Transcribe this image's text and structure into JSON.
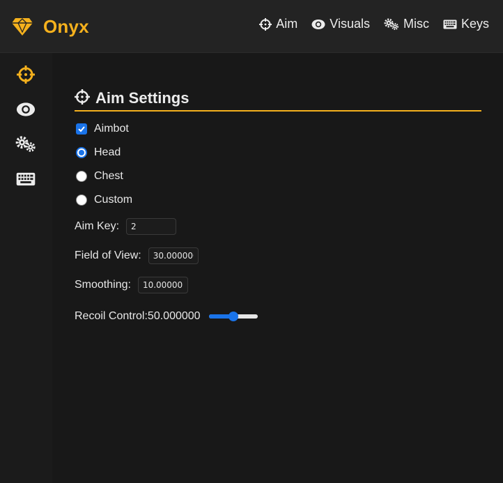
{
  "brand": {
    "name": "Onyx",
    "logo_icon": "gem-icon",
    "accent_color": "#f5b11d"
  },
  "nav": {
    "items": [
      {
        "label": "Aim",
        "icon": "crosshair-icon"
      },
      {
        "label": "Visuals",
        "icon": "eye-icon"
      },
      {
        "label": "Misc",
        "icon": "gears-icon"
      },
      {
        "label": "Keys",
        "icon": "keyboard-icon"
      }
    ]
  },
  "sidebar": {
    "items": [
      {
        "icon": "crosshair-icon",
        "active": true
      },
      {
        "icon": "eye-icon",
        "active": false
      },
      {
        "icon": "gears-icon",
        "active": false
      },
      {
        "icon": "keyboard-icon",
        "active": false
      }
    ]
  },
  "aim_settings": {
    "title": "Aim Settings",
    "aimbot": {
      "label": "Aimbot",
      "checked": true
    },
    "target_options": [
      {
        "label": "Head",
        "checked": true
      },
      {
        "label": "Chest",
        "checked": false
      },
      {
        "label": "Custom",
        "checked": false
      }
    ],
    "aim_key": {
      "label": "Aim Key:",
      "value": "2"
    },
    "fov": {
      "label": "Field of View:",
      "value": "30.000000"
    },
    "smoothing": {
      "label": "Smoothing:",
      "value": "10.000000"
    },
    "recoil_control": {
      "label": "Recoil Control:50.000000",
      "value": 50,
      "min": 0,
      "max": 100
    }
  },
  "colors": {
    "accent": "#f5b11d",
    "control_blue": "#1a73e8",
    "background": "#181818",
    "navbar": "#232323"
  }
}
